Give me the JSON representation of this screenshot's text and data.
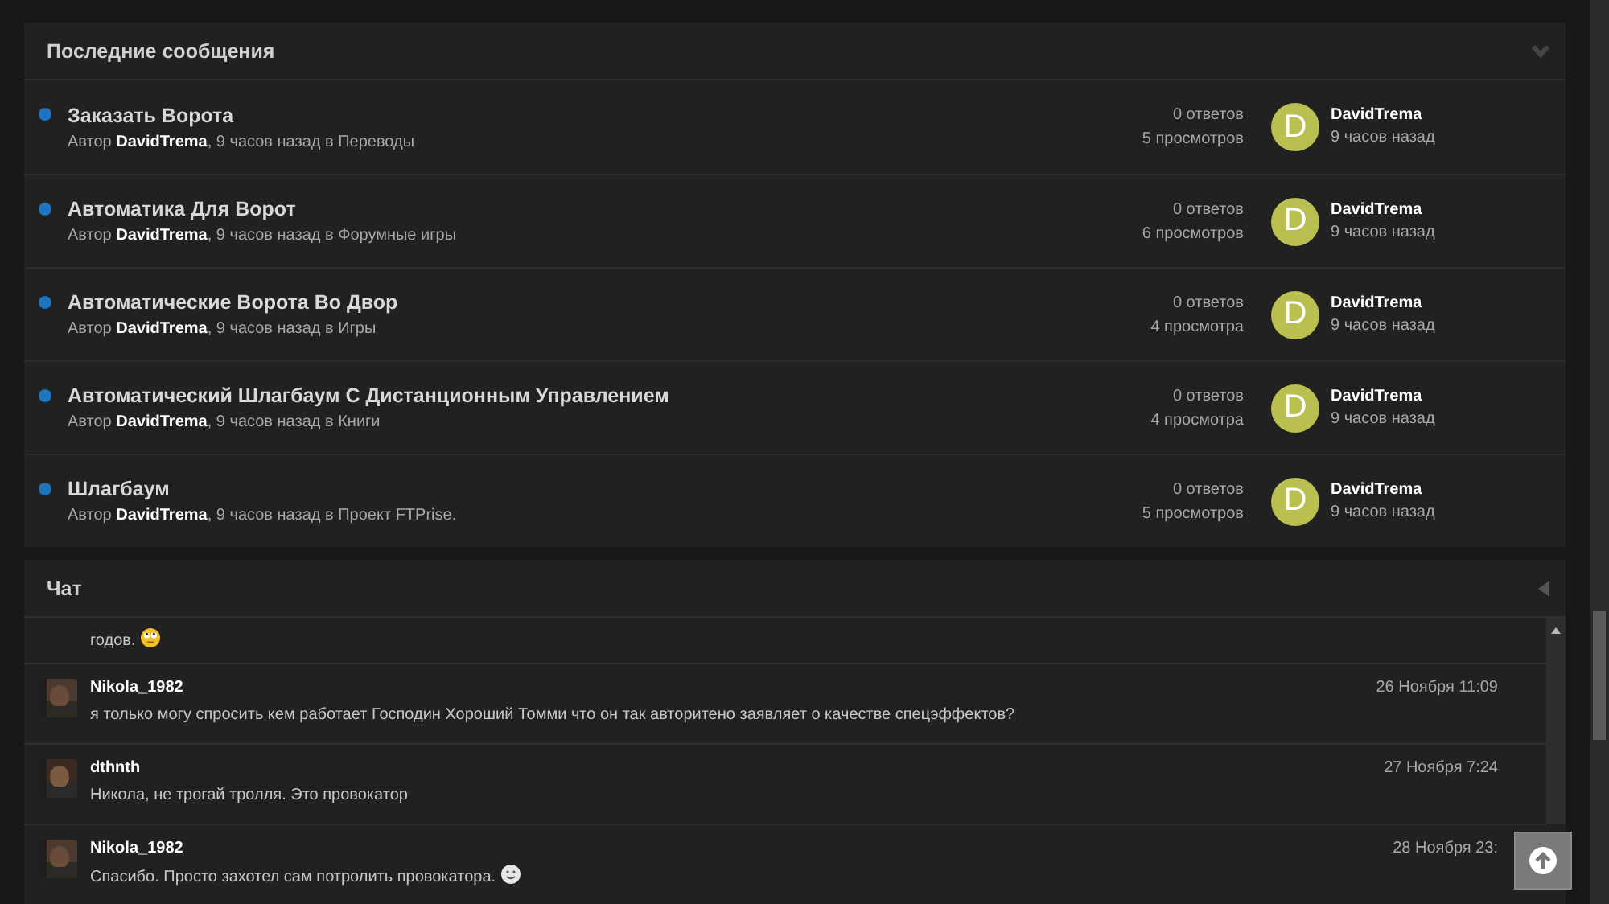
{
  "recent_posts": {
    "title": "Последние сообщения",
    "collapsed": false,
    "topics": [
      {
        "title": "Заказать Ворота",
        "author_prefix": "Автор",
        "author": "DavidTrema",
        "meta": ", 9 часов назад в Переводы",
        "unread": true,
        "replies": "0 ответов",
        "views": "5 просмотров",
        "avatar_letter": "D",
        "last_user": "DavidTrema",
        "last_time": "9 часов назад"
      },
      {
        "title": "Автоматика Для Ворот",
        "author_prefix": "Автор",
        "author": "DavidTrema",
        "meta": ", 9 часов назад в Форумные игры",
        "unread": true,
        "replies": "0 ответов",
        "views": "6 просмотров",
        "avatar_letter": "D",
        "last_user": "DavidTrema",
        "last_time": "9 часов назад"
      },
      {
        "title": "Автоматические Ворота Во Двор",
        "author_prefix": "Автор",
        "author": "DavidTrema",
        "meta": ", 9 часов назад в Игры",
        "unread": true,
        "replies": "0 ответов",
        "views": "4 просмотра",
        "avatar_letter": "D",
        "last_user": "DavidTrema",
        "last_time": "9 часов назад"
      },
      {
        "title": "Автоматический Шлагбаум С Дистанционным Управлением",
        "author_prefix": "Автор",
        "author": "DavidTrema",
        "meta": ", 9 часов назад в Книги",
        "unread": true,
        "replies": "0 ответов",
        "views": "4 просмотра",
        "avatar_letter": "D",
        "last_user": "DavidTrema",
        "last_time": "9 часов назад"
      },
      {
        "title": "Шлагбаум",
        "author_prefix": "Автор",
        "author": "DavidTrema",
        "meta": ", 9 часов назад в Проект FTPrise.",
        "unread": true,
        "replies": "0 ответов",
        "views": "5 просмотров",
        "avatar_letter": "D",
        "last_user": "DavidTrema",
        "last_time": "9 часов назад"
      }
    ]
  },
  "chat": {
    "title": "Чат",
    "messages": [
      {
        "kind": "partial",
        "text": "годов.",
        "emojis": [
          {
            "kind": "rolling-eyes"
          }
        ]
      },
      {
        "kind": "full",
        "user": "Nikola_1982",
        "time": "26 Ноября 11:09",
        "text": "я только могу спросить кем работает Господин Хороший Томми что он так авторитено заявляет о качестве спецэффектов?"
      },
      {
        "kind": "full",
        "user": "dthnth",
        "time": "27 Ноября 7:24",
        "text": "Никола, не трогай тролля. Это провокатор"
      },
      {
        "kind": "full",
        "user": "Nikola_1982",
        "time": "28 Ноября 23:",
        "text": "Спасибо. Просто захотел сам потролить провокатора.",
        "emojis": [
          {
            "kind": "smile"
          }
        ]
      }
    ]
  }
}
